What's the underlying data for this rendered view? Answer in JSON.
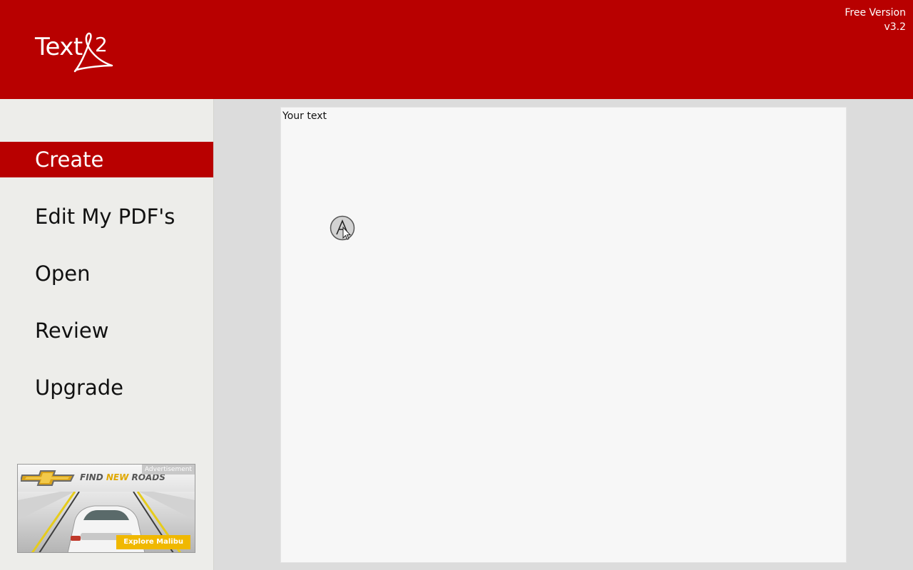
{
  "app": {
    "logo_text": "Text",
    "edition": "Free Version",
    "version": "v3.2"
  },
  "sidebar": {
    "items": [
      {
        "label": "Create",
        "active": true
      },
      {
        "label": "Edit My PDF's",
        "active": false
      },
      {
        "label": "Open",
        "active": false
      },
      {
        "label": "Review",
        "active": false
      },
      {
        "label": "Upgrade",
        "active": false
      }
    ]
  },
  "ad": {
    "badge": "Advertisement",
    "tagline_part1": "FIND ",
    "tagline_highlight": "NEW",
    "tagline_part2": " ROADS",
    "cta": "Explore Malibu"
  },
  "editor": {
    "text": "Your text"
  },
  "colors": {
    "brand_red": "#b80000",
    "sidebar_bg": "#ededea",
    "main_bg": "#dcdcdc",
    "editor_bg": "#f7f7f7",
    "ad_cta": "#f0b800"
  },
  "icons": {
    "logo_mark": "acrobat-2-icon",
    "cursor": "handwriting-cursor-icon"
  }
}
